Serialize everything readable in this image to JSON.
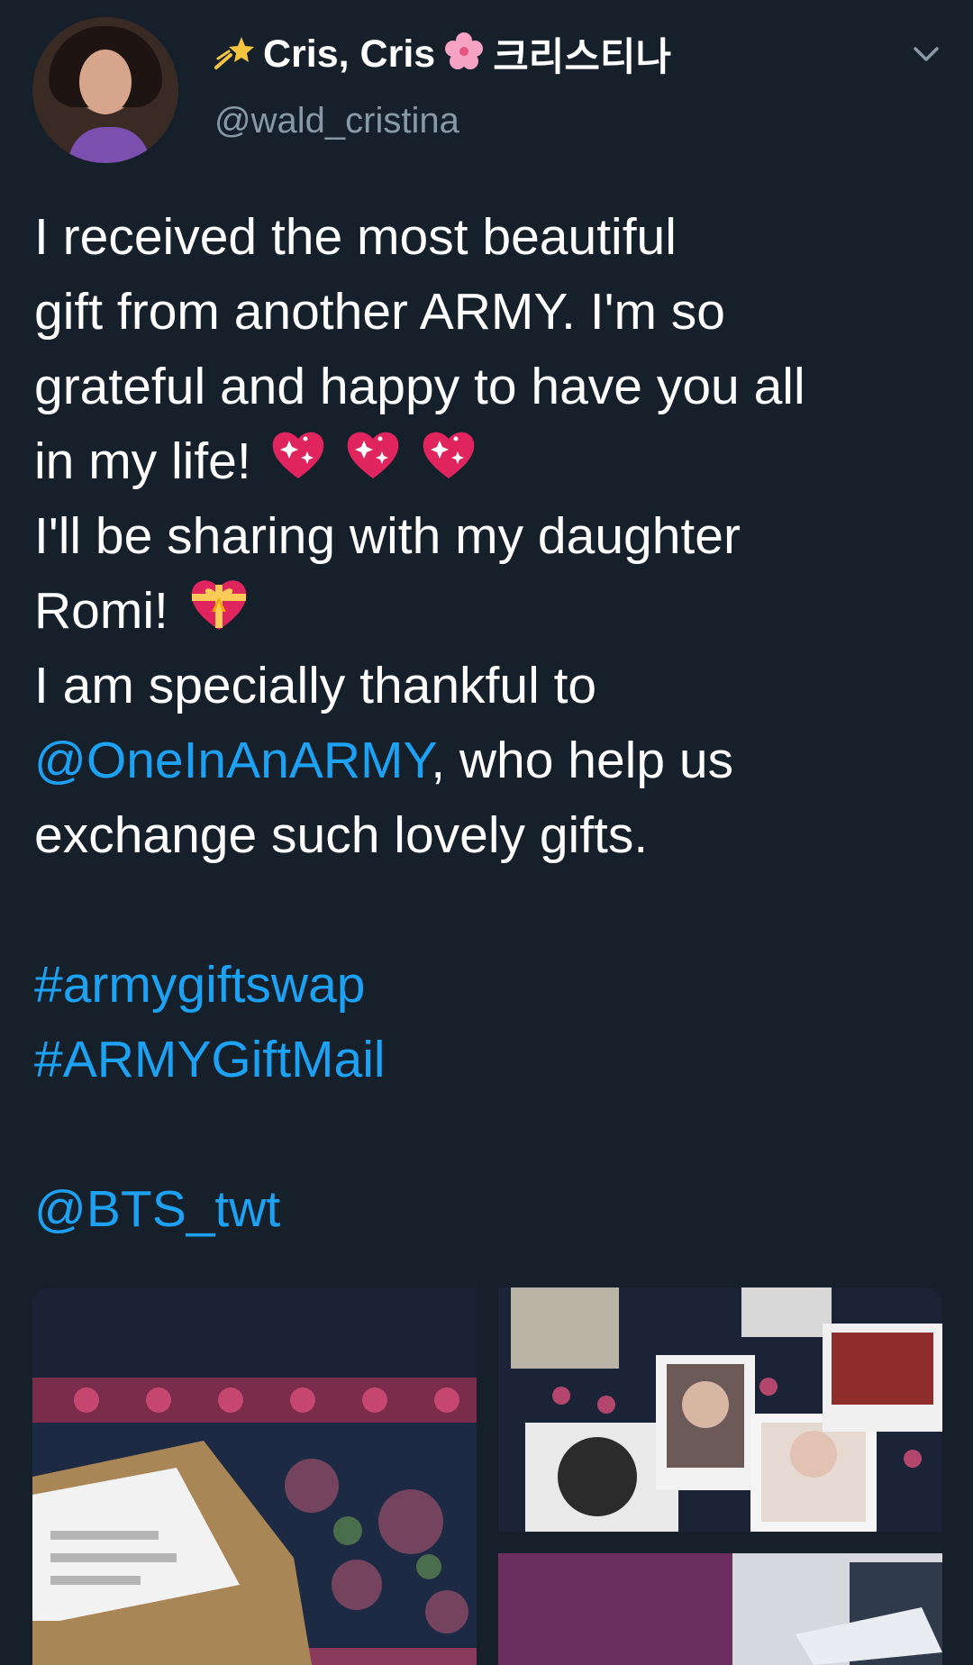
{
  "tweet": {
    "display_name": "Cris, Cris",
    "korean_name": "크리스티나",
    "handle": "@wald_cristina",
    "icons": [
      "shooting-star-icon",
      "cherry-blossom-icon",
      "chevron-down-icon",
      "sparkling-heart-icon",
      "gift-heart-icon"
    ],
    "text_lines": [
      "I received the most beautiful",
      "gift from another ARMY. I'm so",
      "grateful and happy to have you all",
      "in my life!",
      "I'll be sharing with my daughter",
      "Romi!",
      "I am specially thankful to",
      "@OneInAnARMY",
      ", who help us",
      "exchange such lovely gifts.",
      "#armygiftswap",
      "#ARMYGiftMail",
      "@BTS_twt"
    ],
    "link_color": "#1da1f2",
    "background": "#15202b"
  }
}
